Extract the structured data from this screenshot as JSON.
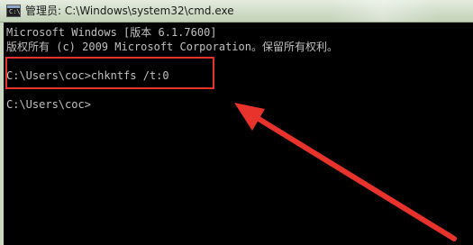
{
  "window": {
    "title": "管理员: C:\\Windows\\system32\\cmd.exe",
    "icon": "cmd-icon",
    "icon_glyph": "C:\\"
  },
  "console": {
    "lines": [
      "Microsoft Windows [版本 6.1.7600]",
      "版权所有 (c) 2009 Microsoft Corporation。保留所有权利。",
      "",
      "C:\\Users\\coc>chkntfs /t:0",
      "",
      "C:\\Users\\coc>"
    ]
  },
  "annotation": {
    "highlight_color": "#e8332c",
    "arrow_color": "#e8332c"
  }
}
